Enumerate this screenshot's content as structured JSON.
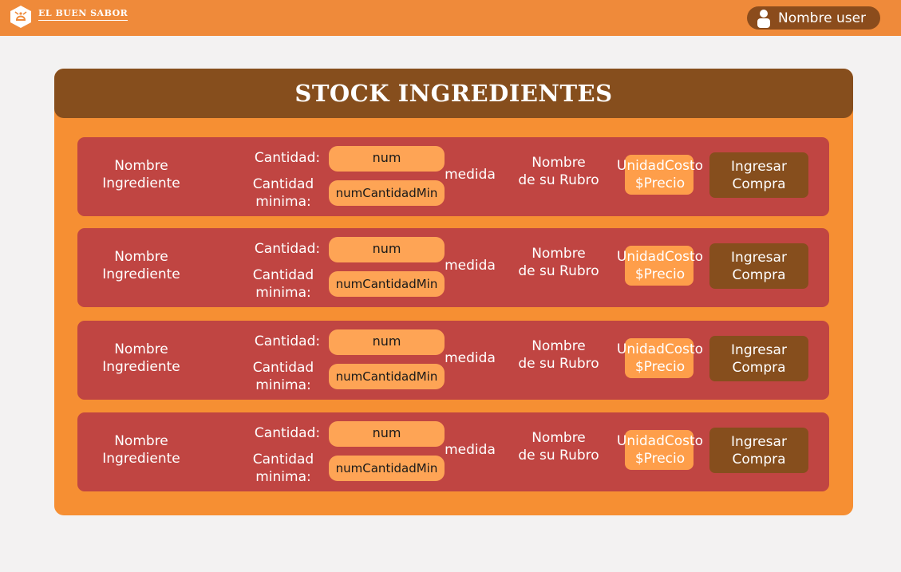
{
  "header": {
    "brand": "EL BUEN SABOR",
    "user_name": "Nombre user",
    "logo_icon": "chef-hat-icon",
    "user_icon": "person-icon"
  },
  "panel": {
    "title": "STOCK INGREDIENTES"
  },
  "rows": [
    {
      "name_line1": "Nombre",
      "name_line2": "Ingrediente",
      "qty_label": "Cantidad:",
      "qty_value": "num",
      "min_label_line1": "Cantidad",
      "min_label_line2": "minima:",
      "min_value": "numCantidadMin",
      "unit": "medida",
      "rubro_line1": "Nombre",
      "rubro_line2": "de su Rubro",
      "price_line1": "UnidadCosto",
      "price_line2": "$Precio",
      "button_line1": "Ingresar",
      "button_line2": "Compra"
    },
    {
      "name_line1": "Nombre",
      "name_line2": "Ingrediente",
      "qty_label": "Cantidad:",
      "qty_value": "num",
      "min_label_line1": "Cantidad",
      "min_label_line2": "minima:",
      "min_value": "numCantidadMin",
      "unit": "medida",
      "rubro_line1": "Nombre",
      "rubro_line2": "de su Rubro",
      "price_line1": "UnidadCosto",
      "price_line2": "$Precio",
      "button_line1": "Ingresar",
      "button_line2": "Compra"
    },
    {
      "name_line1": "Nombre",
      "name_line2": "Ingrediente",
      "qty_label": "Cantidad:",
      "qty_value": "num",
      "min_label_line1": "Cantidad",
      "min_label_line2": "minima:",
      "min_value": "numCantidadMin",
      "unit": "medida",
      "rubro_line1": "Nombre",
      "rubro_line2": "de su Rubro",
      "price_line1": "UnidadCosto",
      "price_line2": "$Precio",
      "button_line1": "Ingresar",
      "button_line2": "Compra"
    },
    {
      "name_line1": "Nombre",
      "name_line2": "Ingrediente",
      "qty_label": "Cantidad:",
      "qty_value": "num",
      "min_label_line1": "Cantidad",
      "min_label_line2": "minima:",
      "min_value": "numCantidadMin",
      "unit": "medida",
      "rubro_line1": "Nombre",
      "rubro_line2": "de su Rubro",
      "price_line1": "UnidadCosto",
      "price_line2": "$Precio",
      "button_line1": "Ingresar",
      "button_line2": "Compra"
    }
  ],
  "colors": {
    "topbar": "#ef8a3a",
    "panel": "#f68f33",
    "panel_header": "#864e1d",
    "row": "#c04542",
    "field": "#fea455",
    "button": "#864e1d"
  }
}
